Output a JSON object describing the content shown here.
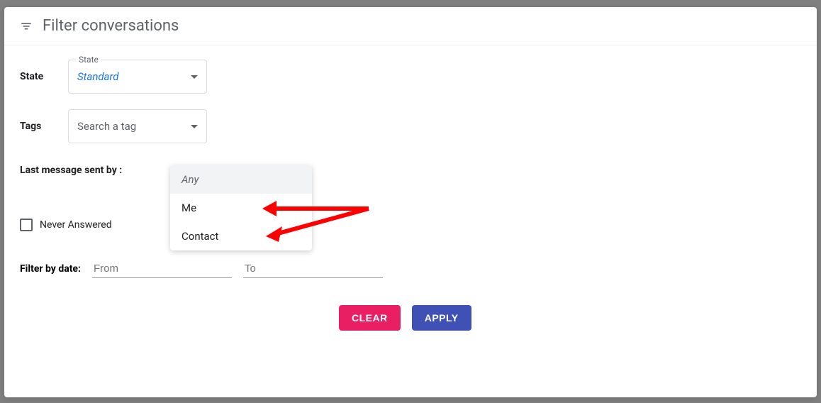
{
  "header": {
    "title": "Filter conversations"
  },
  "state": {
    "label": "State",
    "top_label": "State",
    "value": "Standard"
  },
  "tags": {
    "label": "Tags",
    "placeholder": "Search a tag"
  },
  "last_message": {
    "label": "Last message sent by :",
    "options": [
      "Any",
      "Me",
      "Contact"
    ]
  },
  "never_answered": {
    "label": "Never Answered"
  },
  "date": {
    "label": "Filter by date:",
    "from_placeholder": "From",
    "to_placeholder": "To"
  },
  "buttons": {
    "clear": "CLEAR",
    "apply": "APPLY"
  }
}
